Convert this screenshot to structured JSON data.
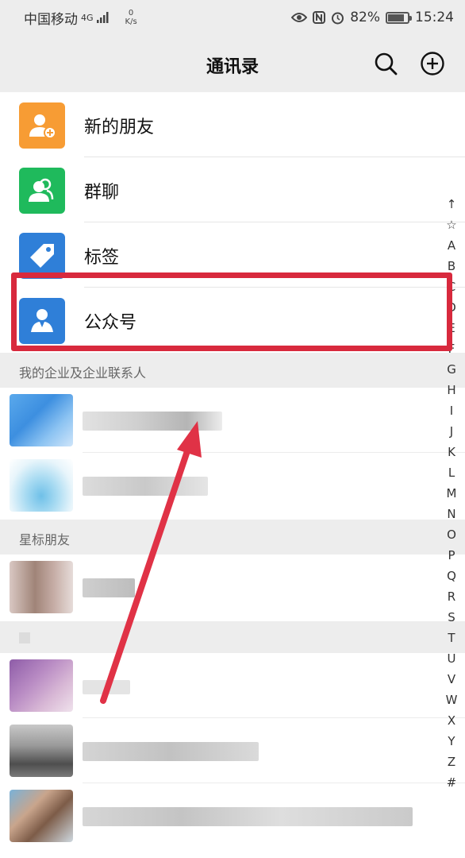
{
  "status_bar": {
    "carrier": "中国移动",
    "network": "4G",
    "net_speed_value": "0",
    "net_speed_unit": "K/s",
    "battery_percent": "82%",
    "battery_level": 0.82,
    "time": "15:24"
  },
  "header": {
    "title": "通讯录",
    "search_icon": "search-icon",
    "add_icon": "plus-circle-icon"
  },
  "fixed_items": [
    {
      "label": "新的朋友",
      "icon": "add-friend-icon",
      "color": "#f79c34"
    },
    {
      "label": "群聊",
      "icon": "group-icon",
      "color": "#1fba5c"
    },
    {
      "label": "标签",
      "icon": "tag-icon",
      "color": "#2f7fd8"
    },
    {
      "label": "公众号",
      "icon": "official-account-icon",
      "color": "#2f7fd8"
    }
  ],
  "sections": {
    "enterprise": "我的企业及企业联系人",
    "starred": "星标朋友"
  },
  "index_bar": [
    "↑",
    "☆",
    "A",
    "B",
    "C",
    "D",
    "E",
    "F",
    "G",
    "H",
    "I",
    "J",
    "K",
    "L",
    "M",
    "N",
    "O",
    "P",
    "Q",
    "R",
    "S",
    "T",
    "U",
    "V",
    "W",
    "X",
    "Y",
    "Z",
    "#"
  ],
  "colors": {
    "highlight": "#d8293d",
    "background": "#ededed"
  }
}
